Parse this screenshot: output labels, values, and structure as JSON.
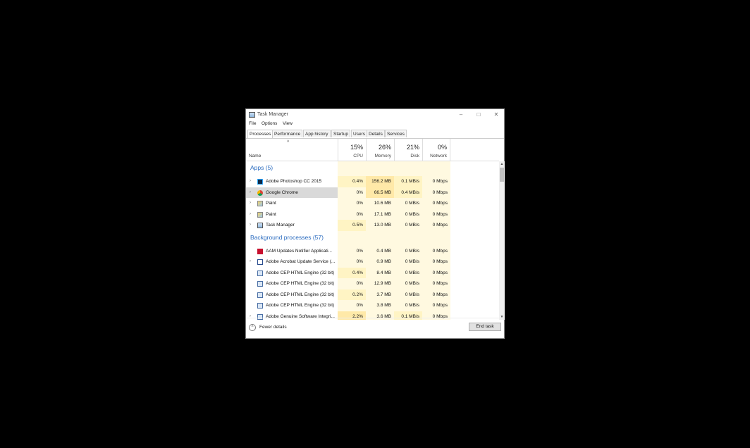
{
  "window": {
    "title": "Task Manager"
  },
  "menu": [
    "File",
    "Options",
    "View"
  ],
  "tabs": [
    "Processes",
    "Performance",
    "App history",
    "Startup",
    "Users",
    "Details",
    "Services"
  ],
  "columns": {
    "name": "Name",
    "cpu": {
      "pct": "15%",
      "label": "CPU"
    },
    "memory": {
      "pct": "26%",
      "label": "Memory"
    },
    "disk": {
      "pct": "21%",
      "label": "Disk"
    },
    "network": {
      "pct": "0%",
      "label": "Network"
    }
  },
  "apps_group": "Apps (5)",
  "apps": [
    {
      "name": "Adobe Photoshop CC 2015",
      "icon": "photoshop-icon",
      "cpu": "0.4%",
      "memory": "156.2 MB",
      "disk": "0.1 MB/s",
      "network": "0 Mbps"
    },
    {
      "name": "Google Chrome",
      "icon": "chrome-icon",
      "cpu": "0%",
      "memory": "66.5 MB",
      "disk": "0.4 MB/s",
      "network": "0 Mbps"
    },
    {
      "name": "Paint",
      "icon": "paint-icon",
      "cpu": "0%",
      "memory": "10.6 MB",
      "disk": "0 MB/s",
      "network": "0 Mbps"
    },
    {
      "name": "Paint",
      "icon": "paint-icon",
      "cpu": "0%",
      "memory": "17.1 MB",
      "disk": "0 MB/s",
      "network": "0 Mbps"
    },
    {
      "name": "Task Manager",
      "icon": "task-manager-icon",
      "cpu": "0.5%",
      "memory": "13.0 MB",
      "disk": "0 MB/s",
      "network": "0 Mbps"
    }
  ],
  "bg_group": "Background processes (57)",
  "bg": [
    {
      "name": "AAM Updates Notifier Applicati...",
      "icon": "adobe-red-icon",
      "cpu": "0%",
      "memory": "0.4 MB",
      "disk": "0 MB/s",
      "network": "0 Mbps"
    },
    {
      "name": "Adobe Acrobat Update Service (...",
      "icon": "window-icon",
      "cpu": "0%",
      "memory": "0.9 MB",
      "disk": "0 MB/s",
      "network": "0 Mbps"
    },
    {
      "name": "Adobe CEP HTML Engine (32 bit)",
      "icon": "process-icon",
      "cpu": "0.4%",
      "memory": "8.4 MB",
      "disk": "0 MB/s",
      "network": "0 Mbps"
    },
    {
      "name": "Adobe CEP HTML Engine (32 bit)",
      "icon": "process-icon",
      "cpu": "0%",
      "memory": "12.9 MB",
      "disk": "0 MB/s",
      "network": "0 Mbps"
    },
    {
      "name": "Adobe CEP HTML Engine (32 bit)",
      "icon": "process-icon",
      "cpu": "0.2%",
      "memory": "3.7 MB",
      "disk": "0 MB/s",
      "network": "0 Mbps"
    },
    {
      "name": "Adobe CEP HTML Engine (32 bit)",
      "icon": "process-icon",
      "cpu": "0%",
      "memory": "3.8 MB",
      "disk": "0 MB/s",
      "network": "0 Mbps"
    },
    {
      "name": "Adobe Genuine Software Integri...",
      "icon": "process-icon",
      "cpu": "2.2%",
      "memory": "3.6 MB",
      "disk": "0.1 MB/s",
      "network": "0 Mbps"
    }
  ],
  "footer": {
    "fewer": "Fewer details",
    "end_task": "End task"
  },
  "colors": {
    "heat_light": "#fff9e0",
    "heat_mid": "#fff4c4",
    "heat_strong": "#ffe9a8",
    "group_blue": "#2a6bbf"
  }
}
